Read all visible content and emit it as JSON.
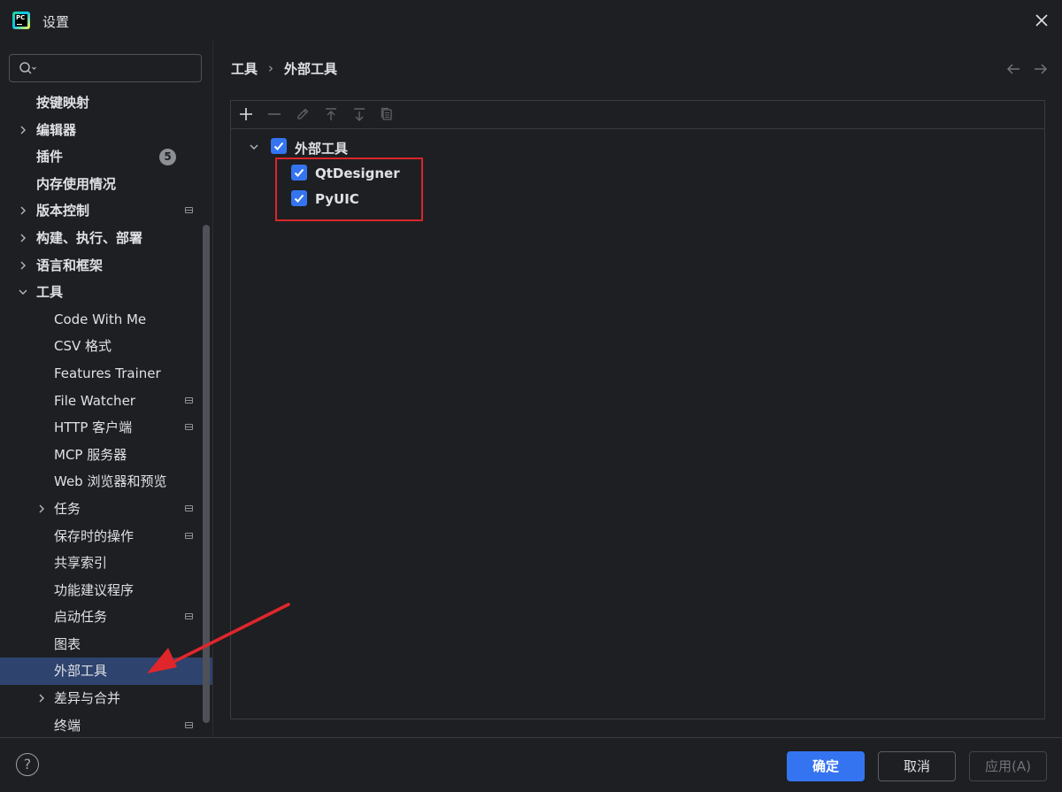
{
  "window": {
    "title": "设置"
  },
  "search": {
    "placeholder": ""
  },
  "sidebar": {
    "items": [
      {
        "label": "按键映射",
        "bold": true
      },
      {
        "label": "编辑器",
        "bold": true,
        "expandable": true
      },
      {
        "label": "插件",
        "bold": true,
        "badge": "5"
      },
      {
        "label": "内存使用情况",
        "bold": true
      },
      {
        "label": "版本控制",
        "bold": true,
        "expandable": true,
        "project": true
      },
      {
        "label": "构建、执行、部署",
        "bold": true,
        "expandable": true
      },
      {
        "label": "语言和框架",
        "bold": true,
        "expandable": true
      },
      {
        "label": "工具",
        "bold": true,
        "expanded": true
      },
      {
        "label": "Code With Me",
        "child": true
      },
      {
        "label": "CSV 格式",
        "child": true
      },
      {
        "label": "Features Trainer",
        "child": true
      },
      {
        "label": "File Watcher",
        "child": true,
        "project": true
      },
      {
        "label": "HTTP 客户端",
        "child": true,
        "project": true
      },
      {
        "label": "MCP 服务器",
        "child": true
      },
      {
        "label": "Web 浏览器和预览",
        "child": true
      },
      {
        "label": "任务",
        "child": true,
        "expandable": true,
        "project": true
      },
      {
        "label": "保存时的操作",
        "child": true,
        "project": true
      },
      {
        "label": "共享索引",
        "child": true
      },
      {
        "label": "功能建议程序",
        "child": true
      },
      {
        "label": "启动任务",
        "child": true,
        "project": true
      },
      {
        "label": "图表",
        "child": true
      },
      {
        "label": "外部工具",
        "child": true,
        "selected": true
      },
      {
        "label": "差异与合并",
        "child": true,
        "expandable": true
      },
      {
        "label": "终端",
        "child": true,
        "project": true
      }
    ]
  },
  "breadcrumb": {
    "parent": "工具",
    "separator": "›",
    "current": "外部工具"
  },
  "toolbar": {
    "icons": [
      "plus-icon",
      "minus-icon",
      "edit-icon",
      "move-up-icon",
      "move-down-icon",
      "copy-icon"
    ]
  },
  "tools_tree": {
    "group": {
      "label": "外部工具",
      "checked": true
    },
    "items": [
      {
        "label": "QtDesigner",
        "checked": true
      },
      {
        "label": "PyUIC",
        "checked": true
      }
    ]
  },
  "footer": {
    "help": "?",
    "ok": "确定",
    "cancel": "取消",
    "apply": "应用(A)"
  },
  "colors": {
    "accent": "#3574f0",
    "selection": "#2e436e",
    "annotation": "#d9262b",
    "background": "#1e1f22"
  }
}
